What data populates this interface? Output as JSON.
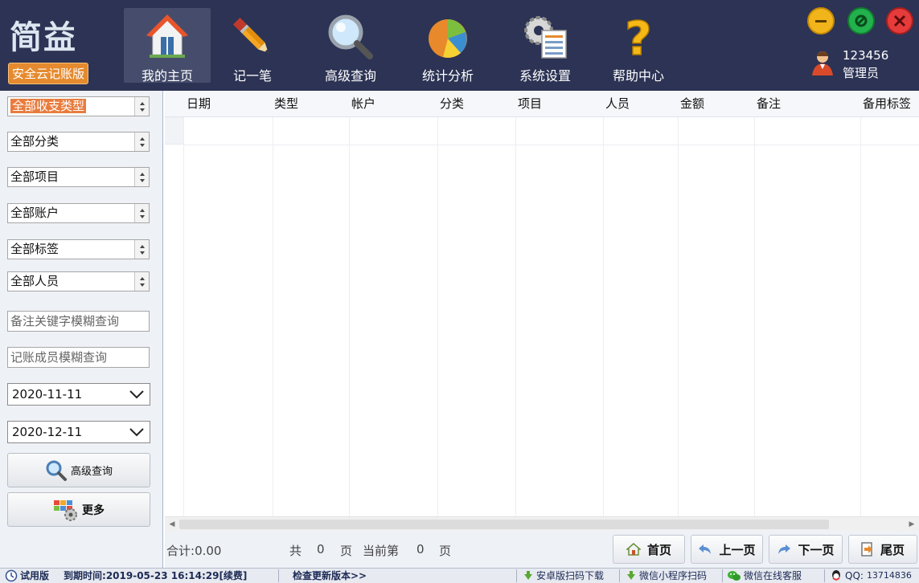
{
  "app": {
    "logo_main": "简益",
    "logo_sub": "安全云记账版"
  },
  "nav": [
    {
      "label": "我的主页",
      "icon": "home-icon",
      "active": true
    },
    {
      "label": "记一笔",
      "icon": "pencil-icon",
      "active": false
    },
    {
      "label": "高级查询",
      "icon": "magnifier-icon",
      "active": false
    },
    {
      "label": "统计分析",
      "icon": "pie-chart-icon",
      "active": false
    },
    {
      "label": "系统设置",
      "icon": "settings-icon",
      "active": false
    },
    {
      "label": "帮助中心",
      "icon": "question-icon",
      "active": false
    }
  ],
  "user": {
    "id": "123456",
    "role": "管理员"
  },
  "colors": {
    "topbar": "#2c3354",
    "minimize": "#f2b41b",
    "maximize": "#22b14c",
    "close": "#e53b3b",
    "highlight": "#e87c3e"
  },
  "filters": {
    "type": "全部收支类型",
    "category": "全部分类",
    "project": "全部项目",
    "account": "全部账户",
    "tag": "全部标签",
    "member": "全部人员",
    "note_placeholder": "备注关键字模糊查询",
    "member_placeholder": "记账成员模糊查询",
    "date_from": "2020-11-11",
    "date_to": "2020-12-11",
    "search_button": "高级查询",
    "more_button": "更多"
  },
  "table": {
    "columns": [
      "日期",
      "类型",
      "帐户",
      "分类",
      "项目",
      "人员",
      "金额",
      "备注",
      "备用标签"
    ],
    "rows": []
  },
  "footer": {
    "total_label": "合计:",
    "total_value": "0.00",
    "pages_prefix": "共",
    "total_pages": "0",
    "pages_suffix": "页",
    "current_prefix": "当前第",
    "current_page": "0",
    "current_suffix": "页",
    "first": "首页",
    "prev": "上一页",
    "next": "下一页",
    "last": "尾页"
  },
  "status": {
    "version": "试用版",
    "expire_label": "到期时间:",
    "expire_value": "2019-05-23 16:14:29[续费]",
    "check_update": "检查更新版本>>",
    "android": "安卓版扫码下载",
    "wechat_mini": "微信小程序扫码",
    "wechat_service": "微信在线客服",
    "qq_label": "QQ:",
    "qq_value": "13714836"
  }
}
